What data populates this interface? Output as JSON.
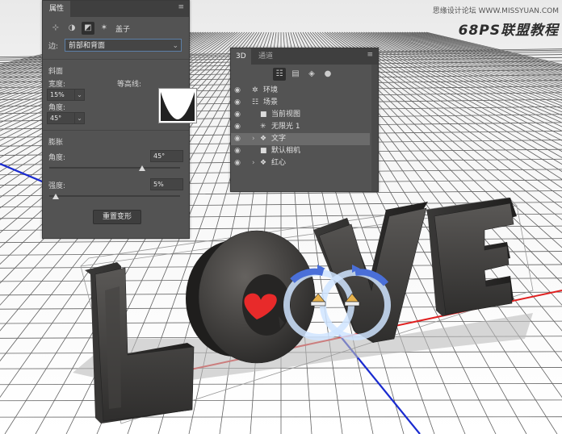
{
  "properties_panel": {
    "title": "属性",
    "icons": [
      "coordinates-icon",
      "deform-icon",
      "cap-icon",
      "tools-icon"
    ],
    "cap_label": "盖子",
    "side_label": "边:",
    "side_value": "前部和背面",
    "bevel_section": "斜面",
    "width_label": "宽度:",
    "width_value": "15%",
    "contour_label": "等高线:",
    "angle_label": "角度:",
    "angle_value": "45°",
    "inflate_section": "膨胀",
    "inflate_angle_label": "角度:",
    "inflate_angle_value": "45°",
    "strength_label": "强度:",
    "strength_value": "5%",
    "reset_button": "重置变形",
    "inflate_angle_slider": 0.71,
    "strength_slider": 0.05
  },
  "panel_3d": {
    "tabs": [
      "3D",
      "通道"
    ],
    "filter_icons": [
      "scene-filter-icon",
      "mesh-filter-icon",
      "material-filter-icon",
      "light-filter-icon"
    ],
    "items": [
      {
        "label": "环境",
        "icon": "environment-icon",
        "level": 0
      },
      {
        "label": "场景",
        "icon": "scene-icon",
        "level": 0
      },
      {
        "label": "当前视图",
        "icon": "camera-icon",
        "level": 1
      },
      {
        "label": "无限光 1",
        "icon": "light-icon",
        "level": 1
      },
      {
        "label": "文字",
        "icon": "mesh-icon",
        "level": 1,
        "selected": true,
        "expandable": true
      },
      {
        "label": "默认相机",
        "icon": "camera-icon",
        "level": 1
      },
      {
        "label": "红心",
        "icon": "mesh-icon",
        "level": 1,
        "expandable": true
      }
    ]
  },
  "watermark": {
    "top": "思缘设计论坛 WWW.MISSYUAN.COM",
    "logo": "68PS联盟教程"
  },
  "colors": {
    "panel_bg": "#535353",
    "selection": "#6b6b6b",
    "axis_red": "#e02020",
    "axis_blue": "#1a2bd0",
    "heart": "#e82a2a",
    "gizmo_blue": "#4a6fd8"
  }
}
